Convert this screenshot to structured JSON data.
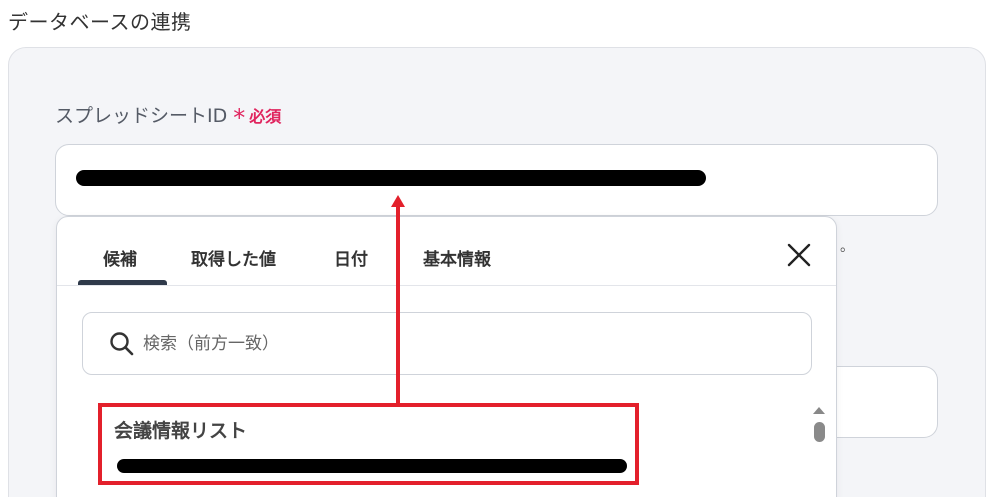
{
  "section_title": "データベースの連携",
  "field": {
    "label": "スプレッドシートID",
    "required_star": "*",
    "required_text": "必須"
  },
  "trailing_dot": "。",
  "popup": {
    "tabs": [
      {
        "label": "候補",
        "active": true
      },
      {
        "label": "取得した値",
        "active": false
      },
      {
        "label": "日付",
        "active": false
      },
      {
        "label": "基本情報",
        "active": false
      }
    ],
    "search_placeholder": "検索（前方一致）",
    "items": [
      {
        "title": "会議情報リスト"
      }
    ]
  },
  "colors": {
    "required": "#e0245e",
    "annotation": "#e3202b",
    "panel_bg": "#f4f5f8"
  }
}
